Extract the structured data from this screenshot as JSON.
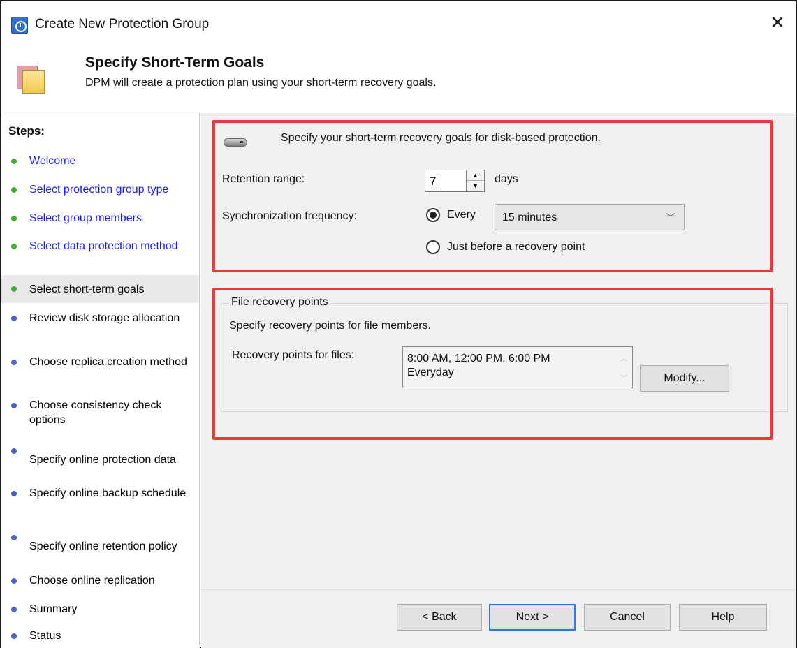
{
  "window": {
    "title": "Create New Protection Group",
    "close_glyph": "✕"
  },
  "header": {
    "title": "Specify Short-Term Goals",
    "subtitle": "DPM will create a protection plan using your short-term recovery goals."
  },
  "steps": {
    "title": "Steps:",
    "items": [
      {
        "label": "Welcome",
        "state": "done"
      },
      {
        "label": "Select protection group type",
        "state": "done"
      },
      {
        "label": "Select group members",
        "state": "done"
      },
      {
        "label": "Select data protection method",
        "state": "done"
      },
      {
        "label": "Select short-term goals",
        "state": "current"
      },
      {
        "label": "Review disk storage allocation",
        "state": "pending"
      },
      {
        "label": "Choose replica creation method",
        "state": "pending"
      },
      {
        "label": "Choose consistency check options",
        "state": "pending"
      },
      {
        "label": "Specify online protection data",
        "state": "pending"
      },
      {
        "label": "Specify online backup schedule",
        "state": "pending"
      },
      {
        "label": "Specify online retention policy",
        "state": "pending"
      },
      {
        "label": "Choose online replication",
        "state": "pending"
      },
      {
        "label": "Summary",
        "state": "pending"
      },
      {
        "label": "Status",
        "state": "pending"
      }
    ]
  },
  "disk_section": {
    "icon": "disk-drive-icon",
    "intro": "Specify your short-term recovery goals for disk-based protection.",
    "retention_label": "Retention range:",
    "retention_value": "7",
    "retention_unit": "days",
    "sync_label": "Synchronization frequency:",
    "every_label": "Every",
    "every_checked": true,
    "frequency_value": "15 minutes",
    "before_recovery_label": "Just before a recovery point",
    "before_recovery_checked": false
  },
  "file_section": {
    "group_title": "File recovery points",
    "intro": "Specify recovery points for file members.",
    "recovery_label": "Recovery points for files:",
    "recovery_lines": [
      "8:00 AM, 12:00 PM, 6:00 PM",
      "Everyday"
    ],
    "modify_label": "Modify..."
  },
  "footer": {
    "back_label": "< Back",
    "next_label": "Next >",
    "cancel_label": "Cancel",
    "help_label": "Help"
  },
  "colors": {
    "highlight_box": "#e03c3c",
    "done_step": "#3fa83a",
    "pending_step": "#4a5fc4",
    "link_text": "#1a1aff"
  }
}
